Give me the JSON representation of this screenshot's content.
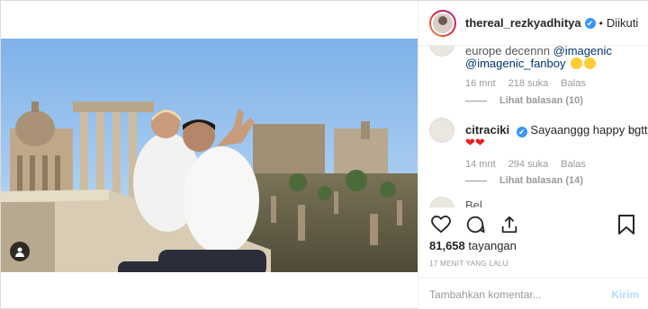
{
  "header": {
    "username": "thereal_rezkyadhitya",
    "follow_label": "Diikuti",
    "dot": "•",
    "verified_mark": "✔"
  },
  "comments": {
    "first": {
      "text_partial": "europe decennn",
      "mention1": "@imagenic",
      "mention2": "@imagenic_fanboy",
      "time": "16 mnt",
      "likes": "218 suka",
      "reply": "Balas",
      "view_replies": "Lihat balasan (10)"
    },
    "second": {
      "username": "citraciki",
      "text": "Sayaanggg happy bgtt",
      "hearts": "❤❤",
      "time": "14 mnt",
      "likes": "294 suka",
      "reply": "Balas",
      "view_replies": "Lihat balasan (14)"
    },
    "third_partial": {
      "text": "Bel"
    }
  },
  "actions": {
    "like_icon": "heart-icon",
    "comment_icon": "comment-icon",
    "share_icon": "share-icon",
    "save_icon": "bookmark-icon"
  },
  "stats": {
    "views_count": "81,658",
    "views_label": "tayangan",
    "time_ago": "17 MENIT YANG LALU"
  },
  "composer": {
    "placeholder": "Tambahkan komentar...",
    "post_label": "Kirim"
  },
  "colors": {
    "accent": "#3897f0",
    "post_disabled": "#b3dbff",
    "heart": "#ed1c24"
  }
}
